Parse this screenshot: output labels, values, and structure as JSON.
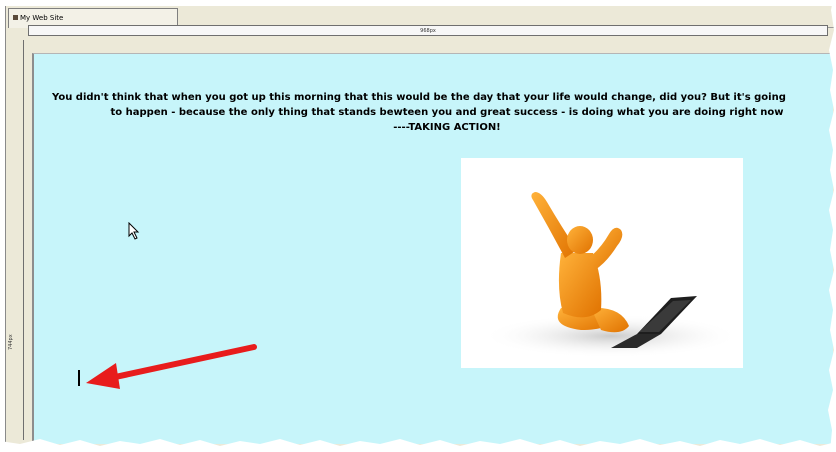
{
  "window": {
    "tab_title": "My Web Site",
    "ruler_top_label": "968px",
    "ruler_left_label": "744px"
  },
  "page": {
    "background_color": "#c7f5fa",
    "headline_line1": "You didn't think that when you got up this morning that this would be the day that your life would change, did you?  But it's going",
    "headline_line2": "to happen - because the only thing that stands bewteen you and great success - is doing what you are doing right now",
    "headline_line3": "----TAKING ACTION!"
  },
  "image": {
    "description_icon": "celebrating-figure-with-laptop"
  },
  "annotation": {
    "arrow_color": "#e81c1c"
  }
}
